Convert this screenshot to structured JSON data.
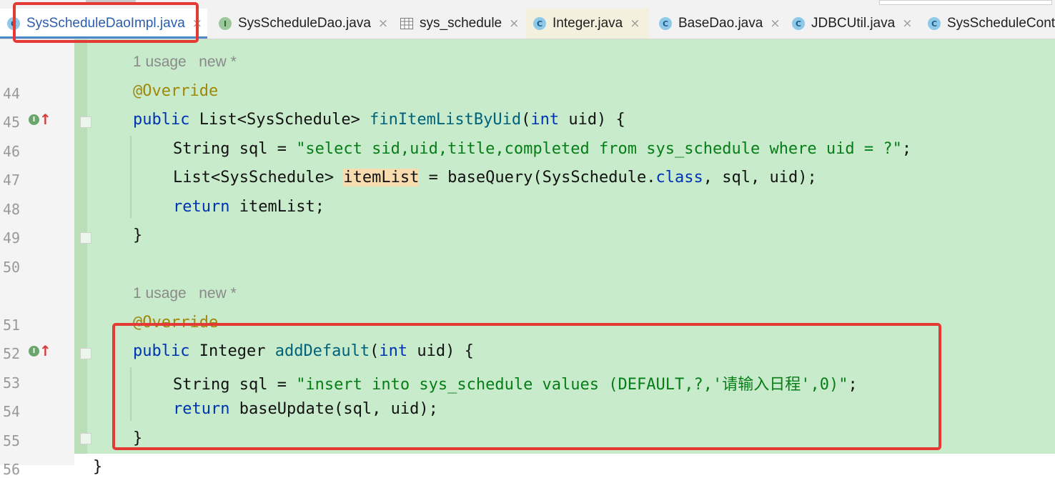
{
  "tabs": [
    {
      "label": "SysScheduleDaoImpl.java",
      "icon": "class-icon",
      "active": true
    },
    {
      "label": "SysScheduleDao.java",
      "icon": "interface-icon"
    },
    {
      "label": "sys_schedule",
      "icon": "table-icon"
    },
    {
      "label": "Integer.java",
      "icon": "class-icon"
    },
    {
      "label": "BaseDao.java",
      "icon": "class-icon"
    },
    {
      "label": "JDBCUtil.java",
      "icon": "class-icon"
    },
    {
      "label": "SysScheduleContr",
      "icon": "class-icon"
    }
  ],
  "close_glyph": "×",
  "interface_badge": "I",
  "class_badge": "C",
  "usage_hint_1": "1 usage   new *",
  "usage_hint_2": "1 usage   new *",
  "line_numbers": [
    "44",
    "45",
    "46",
    "47",
    "48",
    "49",
    "50",
    "51",
    "52",
    "53",
    "54",
    "55",
    "56"
  ],
  "code": {
    "l44": {
      "ann": "@Override"
    },
    "l45": {
      "kw1": "public",
      "t1": " List<SysSchedule> ",
      "fn": "finItemListByUid",
      "t2": "(",
      "kw2": "int",
      "t3": " uid) {"
    },
    "l46": {
      "t1": "String sql = ",
      "str": "\"select sid,uid,title,completed from sys_schedule where uid = ?\"",
      "t2": ";"
    },
    "l47": {
      "t1": "List<SysSchedule> ",
      "var": "itemList",
      "t2": " = baseQuery(SysSchedule.",
      "kw": "class",
      "t3": ", sql, uid);"
    },
    "l48": {
      "kw": "return",
      "t1": " itemList;"
    },
    "l49": {
      "t1": "}"
    },
    "l51": {
      "ann": "@Override"
    },
    "l52": {
      "kw1": "public",
      "t1": " Integer ",
      "fn": "addDefault",
      "t2": "(",
      "kw2": "int",
      "t3": " uid) {"
    },
    "l53": {
      "t1": "String sql = ",
      "str": "\"insert into sys_schedule values (DEFAULT,?,'请输入日程',0)\"",
      "t2": ";"
    },
    "l54": {
      "kw": "return",
      "t1": " baseUpdate(sql, uid);"
    },
    "l55": {
      "t1": "}"
    },
    "l56": {
      "t1": "}"
    }
  },
  "colors": {
    "code_background": "#c7ebcb",
    "keyword": "#0033b3",
    "string": "#067d17",
    "annotation": "#9e880d",
    "highlight_box": "#e53935"
  }
}
